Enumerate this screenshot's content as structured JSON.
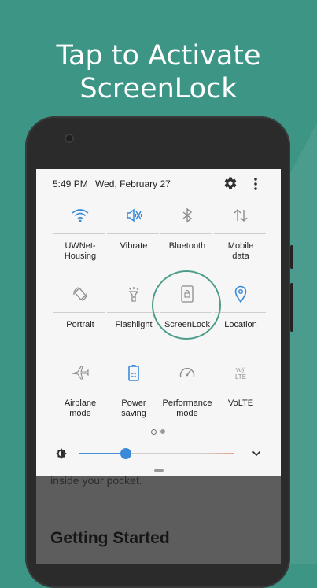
{
  "headline": {
    "line1": "Tap to Activate",
    "line2": "ScreenLock"
  },
  "status": {
    "time": "5:49 PM",
    "separator": "|",
    "date": "Wed, February 27"
  },
  "tiles": [
    {
      "label": "UWNet-\nHousing",
      "icon": "wifi-icon",
      "active": true
    },
    {
      "label": "Vibrate",
      "icon": "vibrate-icon",
      "active": true
    },
    {
      "label": "Bluetooth",
      "icon": "bluetooth-icon",
      "active": false
    },
    {
      "label": "Mobile\ndata",
      "icon": "mobile-data-icon",
      "active": false
    },
    {
      "label": "Portrait",
      "icon": "rotate-icon",
      "active": false
    },
    {
      "label": "Flashlight",
      "icon": "flashlight-icon",
      "active": false
    },
    {
      "label": "ScreenLock",
      "icon": "screenlock-icon",
      "active": false
    },
    {
      "label": "Location",
      "icon": "location-icon",
      "active": true
    },
    {
      "label": "Airplane\nmode",
      "icon": "airplane-icon",
      "active": false
    },
    {
      "label": "Power\nsaving",
      "icon": "battery-saver-icon",
      "active": true
    },
    {
      "label": "Performance\nmode",
      "icon": "gauge-icon",
      "active": false
    },
    {
      "label": "VoLTE",
      "icon": "volte-icon",
      "active": false
    }
  ],
  "page_indicator": {
    "current": 1,
    "total": 2
  },
  "brightness": {
    "level": 0.3
  },
  "app": {
    "body_text": "inside your pocket.",
    "heading": "Getting Started"
  },
  "colors": {
    "background": "#3d9585",
    "accent": "#3a8ad8",
    "ring": "#4d9c8c"
  }
}
